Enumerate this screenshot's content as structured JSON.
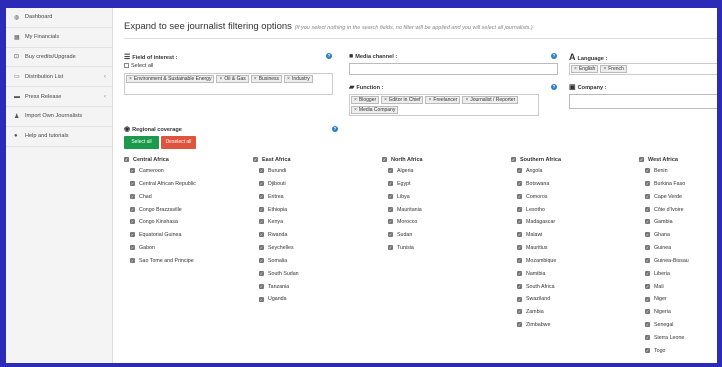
{
  "sidebar": {
    "items": [
      {
        "label": "Dashboard",
        "icon": "dashboard-icon",
        "glyph": "◍",
        "has_chevron": false
      },
      {
        "label": "My Financials",
        "icon": "financials-icon",
        "glyph": "▦",
        "has_chevron": false
      },
      {
        "label": "Buy credits/Upgrade",
        "icon": "credits-icon",
        "glyph": "⊡",
        "has_chevron": false
      },
      {
        "label": "Distribution List",
        "icon": "list-icon",
        "glyph": "▭",
        "has_chevron": true
      },
      {
        "label": "Press Release",
        "icon": "press-release-icon",
        "glyph": "▬",
        "has_chevron": true
      },
      {
        "label": "Import Own Journalists",
        "icon": "import-icon",
        "glyph": "♟",
        "has_chevron": false
      },
      {
        "label": "Help and tutorials",
        "icon": "help-icon",
        "glyph": "●",
        "has_chevron": false
      }
    ],
    "chevron": "‹"
  },
  "main": {
    "title": "Expand to see journalist filtering options",
    "subtitle": "(If you select nothing in the search fields, no filter will be applied and you will select all journalists.)"
  },
  "filters": {
    "field_of_interest": {
      "label": "Field of interest :",
      "select_all": "Select all",
      "tags": [
        "Environment & Sustainable Energy",
        "Oil & Gas",
        "Business",
        "Industry"
      ]
    },
    "media_channel": {
      "label": "Media channel :",
      "value": ""
    },
    "function": {
      "label": "Function :",
      "tags": [
        "Blogger",
        "Editor in Chief",
        "Freelancer",
        "Journalist / Reporter",
        "Media Company"
      ]
    },
    "language": {
      "label": "Language :",
      "tags": [
        "English",
        "French"
      ]
    },
    "company": {
      "label": "Company :",
      "value": ""
    },
    "tag_remove": "×",
    "help": "?"
  },
  "regional": {
    "label": "Regional coverage",
    "select_all_button": "Select all",
    "deselect_all_button": "Deselect all",
    "check_glyph": "✓",
    "regions": [
      {
        "name": "Central Africa",
        "countries": [
          "Cameroon",
          "Central African Republic",
          "Chad",
          "Congo Brazzaville",
          "Congo Kinshasa",
          "Equatorial Guinea",
          "Gabon",
          "Sao Tome and Principe"
        ]
      },
      {
        "name": "East Africa",
        "countries": [
          "Burundi",
          "Djibouti",
          "Eritrea",
          "Ethiopia",
          "Kenya",
          "Rwanda",
          "Seychelles",
          "Somalia",
          "South Sudan",
          "Tanzania",
          "Uganda"
        ]
      },
      {
        "name": "North Africa",
        "countries": [
          "Algeria",
          "Egypt",
          "Libya",
          "Mauritania",
          "Morocco",
          "Sudan",
          "Tunisia"
        ]
      },
      {
        "name": "Southern Africa",
        "countries": [
          "Angola",
          "Botswana",
          "Comoros",
          "Lesotho",
          "Madagascar",
          "Malawi",
          "Mauritius",
          "Mozambique",
          "Namibia",
          "South Africa",
          "Swaziland",
          "Zambia",
          "Zimbabwe"
        ]
      },
      {
        "name": "West Africa",
        "countries": [
          "Benin",
          "Burkina Faso",
          "Cape Verde",
          "Côte d'Ivoire",
          "Gambia",
          "Ghana",
          "Guinea",
          "Guinea-Bissau",
          "Liberia",
          "Mali",
          "Niger",
          "Nigeria",
          "Senegal",
          "Sierra Leone",
          "Togo"
        ]
      }
    ]
  },
  "colors": {
    "frame": "#2b2bb8",
    "select_all": "#1a9a4a",
    "deselect_all": "#e0533e",
    "help": "#2a7fc6"
  }
}
